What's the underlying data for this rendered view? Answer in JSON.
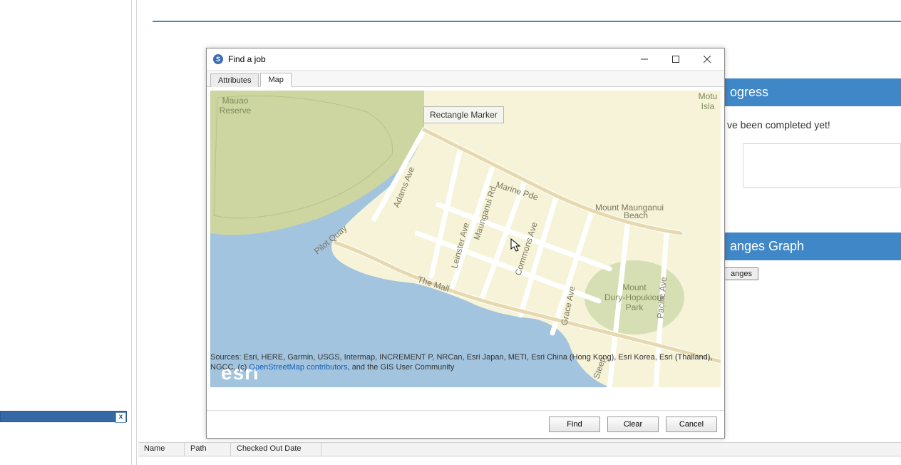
{
  "background": {
    "progress_header": "ogress",
    "progress_text": "ve been completed yet!",
    "graph_header": "anges Graph",
    "graph_button": "anges",
    "columns": {
      "name": "Name",
      "path": "Path",
      "checked_out": "Checked Out Date"
    },
    "close_thumb": "x"
  },
  "dialog": {
    "title": "Find a job",
    "tabs": {
      "attributes": "Attributes",
      "map": "Map"
    },
    "tooltip": "Rectangle  Marker",
    "attribution_prefix": "Sources: Esri, HERE, Garmin, USGS, Intermap, INCREMENT P, NRCan, Esri Japan, METI, Esri China (Hong Kong), Esri Korea, Esri (Thailand), NGCC, (c) ",
    "attribution_link": "OpenStreetMap contributors",
    "attribution_suffix": ", and the GIS User Community",
    "buttons": {
      "find": "Find",
      "clear": "Clear",
      "cancel": "Cancel"
    }
  },
  "map": {
    "logo": "esri",
    "labels": {
      "mauao_reserve_a": "Mauao",
      "mauao_reserve_b": "Reserve",
      "motu_a": "Motu",
      "motu_b": "Isla",
      "mt_dury_a": "Mount",
      "mt_dury_b": "Dury-Hopukiore",
      "mt_dury_c": "Park",
      "marine_pde": "Marine Pde",
      "mt_maunganui_beach_a": "Mount Maunganui",
      "mt_maunganui_beach_b": "Beach",
      "adams": "Adams Ave",
      "pilot": "Pilot Quay",
      "mall": "The Mall",
      "leinster": "Leinster Ave",
      "maunganui": "Maunganui Rd",
      "commons": "Commons Ave",
      "grace": "Grace Ave",
      "pacific": "Pacific Ave",
      "steep": "Steep"
    },
    "colors": {
      "ocean": "#a2c4de",
      "land": "#f6f3d9",
      "reserve": "#cdd5a1",
      "park": "#d6dfb3",
      "road": "#écécéc"
    }
  }
}
